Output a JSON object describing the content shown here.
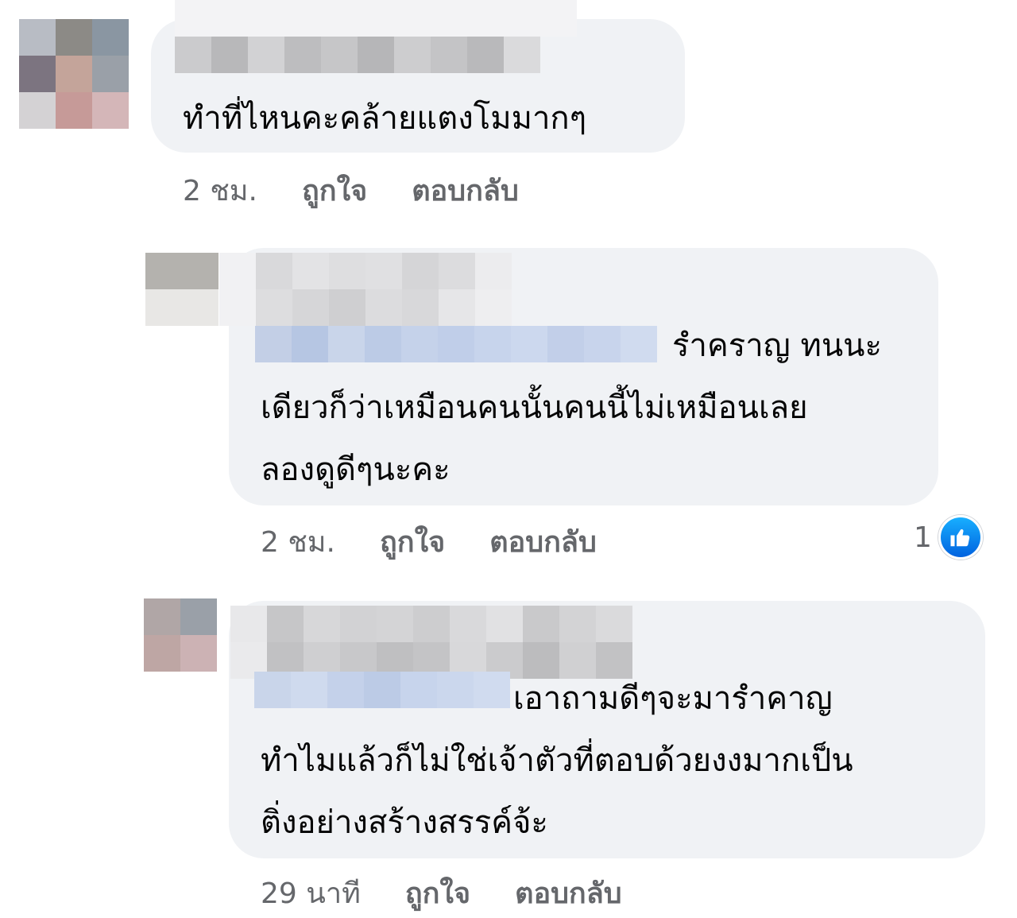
{
  "comments": [
    {
      "text_lines": [
        "ทำที่ไหนคะคล้ายแตงโมมากๆ"
      ],
      "time": "2 ชม.",
      "like_label": "ถูกใจ",
      "reply_label": "ตอบกลับ"
    },
    {
      "text_lines": [
        "รำคราญ ทนนะ",
        "เดียวก็ว่าเหมือนคนนั้นคนนี้ไม่เหมือนเลย",
        "ลองดูดีๆนะคะ"
      ],
      "time": "2 ชม.",
      "like_label": "ถูกใจ",
      "reply_label": "ตอบกลับ",
      "reaction_count": "1"
    },
    {
      "text_lines": [
        "เอาถามดีๆจะมารำคาญ",
        "ทำไมแล้วก็ไม่ใช่เจ้าตัวที่ตอบด้วยงงมากเป็น",
        "ติ่งอย่างสร้างสรรค์จ้ะ"
      ],
      "time": "29 นาที",
      "like_label": "ถูกใจ",
      "reply_label": "ตอบกลับ"
    }
  ],
  "colors": {
    "bubble": "#f0f2f5",
    "meta": "#65676b",
    "like_blue": "#1877f2"
  }
}
